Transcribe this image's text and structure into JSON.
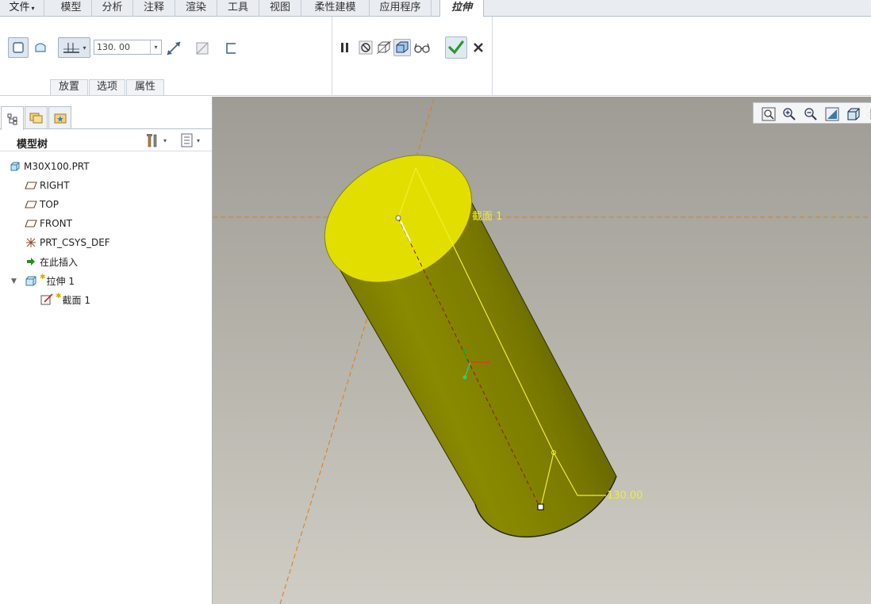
{
  "menubar": {
    "file": "文件",
    "tabs": [
      "模型",
      "分析",
      "注释",
      "渲染",
      "工具",
      "视图",
      "柔性建模",
      "应用程序"
    ],
    "active_tab": "拉伸"
  },
  "ribbon": {
    "depth_value": "130. 00",
    "subtabs": [
      "放置",
      "选项",
      "属性"
    ]
  },
  "panel": {
    "title": "模型树",
    "tree": [
      {
        "label": "M30X100.PRT",
        "icon": "part-icon"
      },
      {
        "label": "RIGHT",
        "icon": "datum-plane-icon"
      },
      {
        "label": "TOP",
        "icon": "datum-plane-icon"
      },
      {
        "label": "FRONT",
        "icon": "datum-plane-icon"
      },
      {
        "label": "PRT_CSYS_DEF",
        "icon": "csys-icon"
      },
      {
        "label": "在此插入",
        "icon": "insert-here-arrow-icon"
      },
      {
        "label": "拉伸 1",
        "icon": "extrude-feature-icon"
      },
      {
        "label": "截面 1",
        "icon": "sketch-icon"
      }
    ]
  },
  "viewport": {
    "section_label": "截面 1",
    "dimension_label": "130.00",
    "colors": {
      "cap": "#e2df00",
      "body": "#7f7f00",
      "annotation": "#f0ee30",
      "datum": "#e07a1a"
    }
  }
}
